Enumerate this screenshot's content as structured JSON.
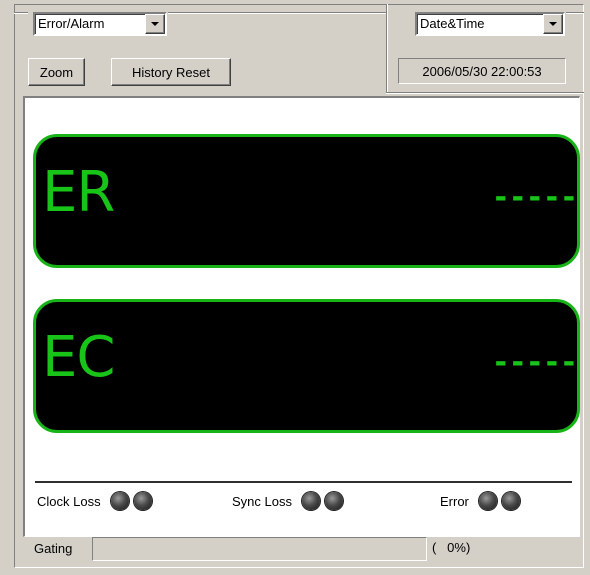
{
  "error_alarm_select": {
    "value": "Error/Alarm"
  },
  "datetime_select": {
    "value": "Date&Time"
  },
  "buttons": {
    "zoom_label": "Zoom",
    "history_reset_label": "History Reset"
  },
  "datetime_display": "2006/05/30 22:00:53",
  "readouts": [
    {
      "label": "ER",
      "value": "-----"
    },
    {
      "label": "EC",
      "value": "-----"
    }
  ],
  "indicators": {
    "clock_loss_label": "Clock Loss",
    "sync_loss_label": "Sync Loss",
    "error_label": "Error"
  },
  "gating": {
    "label": "Gating",
    "progress": 0,
    "percent_text": "(   0%)"
  },
  "colors": {
    "display_green": "#18c418",
    "display_border_green": "#17b317",
    "panel_bg": "#d4d0c8"
  },
  "icons": {
    "dropdown_arrow": "chevron-down-icon",
    "led": "led-indicator-icon"
  }
}
